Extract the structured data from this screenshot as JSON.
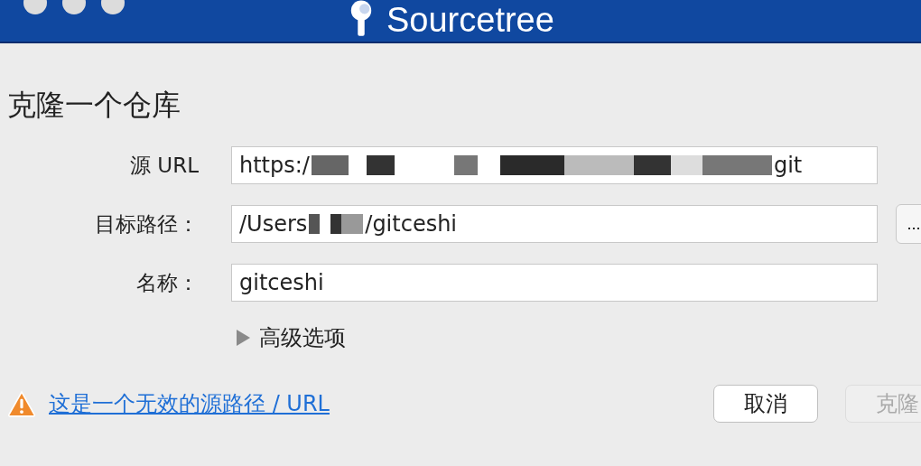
{
  "window": {
    "title": "Sourcetree"
  },
  "heading": "克隆一个仓库",
  "fields": [
    {
      "label": "源 URL",
      "value_start": "https:/",
      "value_end": "git",
      "redacted": true
    },
    {
      "label": "目标路径：",
      "value_start": "/Users",
      "value_end": "/gitceshi",
      "redacted": true,
      "browse": "..."
    },
    {
      "label": "名称：",
      "value_start": "gitceshi",
      "redacted": false
    }
  ],
  "advanced": {
    "label": "高级选项",
    "expanded": false
  },
  "warning": "这是一个无效的源路径 / URL",
  "buttons": [
    {
      "label": "取消",
      "disabled": false
    },
    {
      "label": "克隆",
      "disabled": true
    }
  ]
}
